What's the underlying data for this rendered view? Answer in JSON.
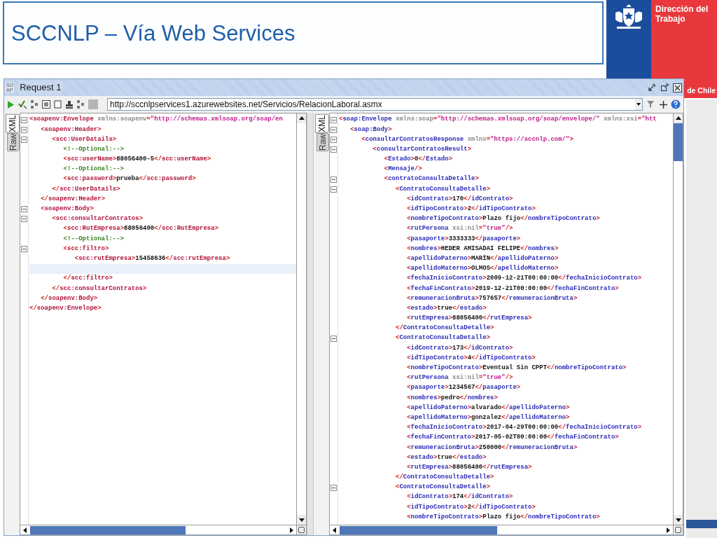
{
  "slide": {
    "title": "SCCNLP – Vía Web Services",
    "logo_lines": [
      "Dirección del",
      "Trabajo"
    ],
    "logo_footer": "de Chile"
  },
  "window": {
    "badge": [
      "SO",
      "AP"
    ],
    "title": "Request 1",
    "url": "http://sccnlpservices1.azurewebsites.net/Servicios/RelacionLaboral.asmx"
  },
  "request": {
    "tabs": [
      {
        "label": "XML",
        "selected": true
      },
      {
        "label": "Raw",
        "selected": false
      }
    ],
    "lines": [
      {
        "text": "<soapenv:Envelope xmlns:soapenv=\"http://schemas.xmlsoap.org/soap/en",
        "end": "</soapenv:Envelope>",
        "children": [
          {
            "text": "<soapenv:Header>",
            "end": "</soapenv:Header>",
            "children": [
              {
                "text": "<scc:UserDatails>",
                "end": "</scc:UserDatails>",
                "children": [
                  {
                    "text": "<!--Optional:-->"
                  },
                  {
                    "text": "<scc:userName>88056400-5</scc:userName>"
                  },
                  {
                    "text": "<!--Optional:-->"
                  },
                  {
                    "text": "<scc:password>prueba</scc:password>"
                  }
                ]
              }
            ]
          },
          {
            "text": "<soapenv:Body>",
            "end": "</soapenv:Body>",
            "children": [
              {
                "text": "<scc:consultarContratos>",
                "end": "</scc:consultarContratos>",
                "children": [
                  {
                    "text": "<scc:RutEmpresa>88056400</scc:RutEmpresa>"
                  },
                  {
                    "text": "<!--Optional:-->"
                  },
                  {
                    "text": "<scc:filtro>",
                    "end": "</scc:filtro>",
                    "children": [
                      {
                        "text": "<scc:rutEmpresa>15458636</scc:rutEmpresa>"
                      },
                      {
                        "kind": "cursor"
                      }
                    ]
                  }
                ]
              }
            ]
          }
        ]
      }
    ]
  },
  "response": {
    "tabs": [
      {
        "label": "XML",
        "selected": true
      },
      {
        "label": "Raw",
        "selected": false
      }
    ],
    "lines": [
      {
        "text": "<soap:Envelope xmlns:soap=\"http://schemas.xmlsoap.org/soap/envelope/\" xmlns:xsi=\"htt",
        "children": [
          {
            "text": "<soap:Body>",
            "children": [
              {
                "text": "<consultarContratosResponse xmlns=\"https://sccnlp.com/\">",
                "children": [
                  {
                    "text": "<consultarContratosResult>",
                    "children": [
                      {
                        "text": "<Estado>0</Estado>"
                      },
                      {
                        "text": "<Mensaje/>"
                      },
                      {
                        "text": "<contratoConsultaDetalle>",
                        "children": [
                          {
                            "text": "<ContratoConsultaDetalle>",
                            "end": "</ContratoConsultaDetalle>",
                            "children": [
                              {
                                "text": "<idContrato>170</idContrato>"
                              },
                              {
                                "text": "<idTipoContrato>2</idTipoContrato>"
                              },
                              {
                                "text": "<nombreTipoContrato>Plazo fijo</nombreTipoContrato>"
                              },
                              {
                                "text": "<rutPersona xsi:nil=\"true\"/>"
                              },
                              {
                                "text": "<pasaporte>3333333</pasaporte>"
                              },
                              {
                                "text": "<nombres>HEDER AMISADAI FELIPE</nombres>"
                              },
                              {
                                "text": "<apellidoPaterno>MARÍN</apellidoPaterno>"
                              },
                              {
                                "text": "<apellidoMaterno>OLMOS</apellidoMaterno>"
                              },
                              {
                                "text": "<fechaInicioContrato>2009-12-21T00:00:00</fechaInicioContrato>"
                              },
                              {
                                "text": "<fechaFinContrato>2019-12-21T00:00:00</fechaFinContrato>"
                              },
                              {
                                "text": "<remuneracionBruta>757657</remuneracionBruta>"
                              },
                              {
                                "text": "<estado>true</estado>"
                              },
                              {
                                "text": "<rutEmpresa>88056400</rutEmpresa>"
                              }
                            ]
                          },
                          {
                            "text": "<ContratoConsultaDetalle>",
                            "end": "</ContratoConsultaDetalle>",
                            "children": [
                              {
                                "text": "<idContrato>173</idContrato>"
                              },
                              {
                                "text": "<idTipoContrato>4</idTipoContrato>"
                              },
                              {
                                "text": "<nombreTipoContrato>Eventual Sin CPPT</nombreTipoContrato>"
                              },
                              {
                                "text": "<rutPersona xsi:nil=\"true\"/>"
                              },
                              {
                                "text": "<pasaporte>1234567</pasaporte>"
                              },
                              {
                                "text": "<nombres>pedro</nombres>"
                              },
                              {
                                "text": "<apellidoPaterno>alvarado</apellidoPaterno>"
                              },
                              {
                                "text": "<apellidoMaterno>gonzalez</apellidoMaterno>"
                              },
                              {
                                "text": "<fechaInicioContrato>2017-04-29T00:00:00</fechaInicioContrato>"
                              },
                              {
                                "text": "<fechaFinContrato>2017-05-02T00:00:00</fechaFinContrato>"
                              },
                              {
                                "text": "<remuneracionBruta>250000</remuneracionBruta>"
                              },
                              {
                                "text": "<estado>true</estado>"
                              },
                              {
                                "text": "<rutEmpresa>88056400</rutEmpresa>"
                              }
                            ]
                          },
                          {
                            "text": "<ContratoConsultaDetalle>",
                            "children": [
                              {
                                "text": "<idContrato>174</idContrato>"
                              },
                              {
                                "text": "<idTipoContrato>2</idTipoContrato>"
                              },
                              {
                                "text": "<nombreTipoContrato>Plazo fijo</nombreTipoContrato>"
                              }
                            ]
                          }
                        ]
                      }
                    ]
                  }
                ]
              }
            ]
          }
        ]
      }
    ]
  }
}
